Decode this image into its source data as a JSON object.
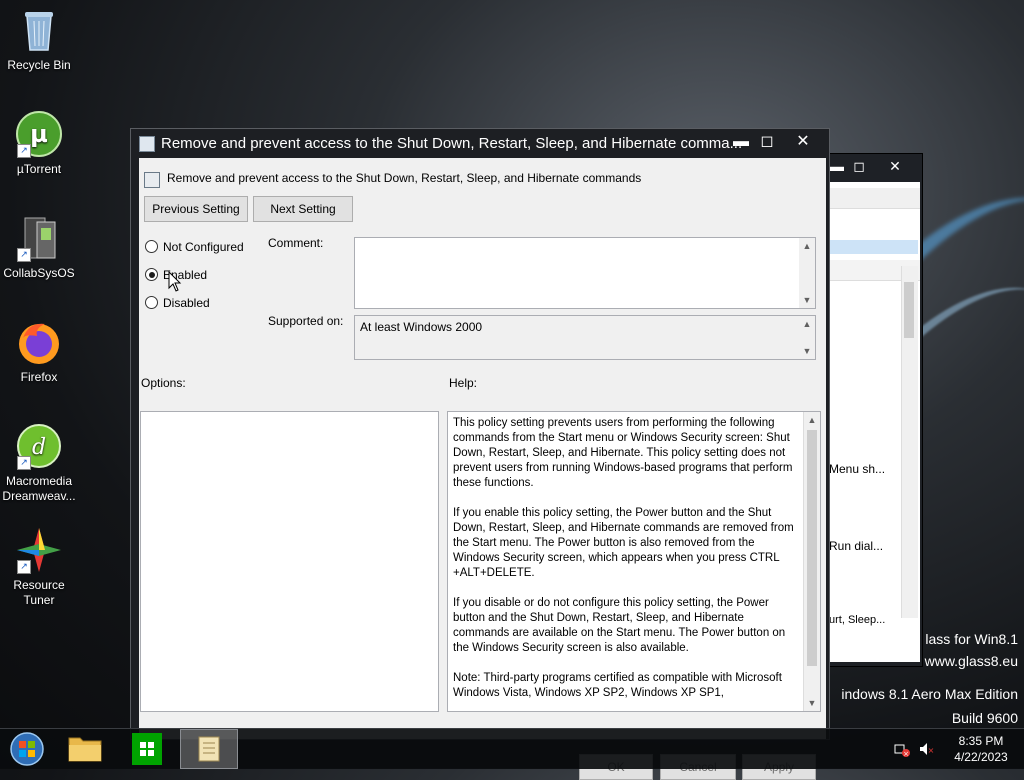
{
  "desktop": {
    "icons": [
      {
        "label": "Recycle Bin"
      },
      {
        "label": "µTorrent"
      },
      {
        "label": "CollabSysOS"
      },
      {
        "label": "Firefox"
      },
      {
        "label": "Macromedia Dreamweav..."
      },
      {
        "label": "Resource Tuner"
      }
    ],
    "watermark": {
      "line1": "lass for Win8.1",
      "line2": "www.glass8.eu",
      "line3": "indows 8.1 Aero Max Edition",
      "line4": "Build 9600"
    }
  },
  "back_window": {
    "items": [
      "Menu sh...",
      "Run dial...",
      "urt, Sleep..."
    ],
    "min": "▬",
    "max": "◻",
    "close": "✕"
  },
  "dialog": {
    "title": "Remove and prevent access to the Shut Down, Restart, Sleep, and Hibernate comma...",
    "header": "Remove and prevent access to the Shut Down, Restart, Sleep, and Hibernate commands",
    "min": "▬",
    "max": "◻",
    "close": "✕",
    "prev_button": "Previous Setting",
    "next_button": "Next Setting",
    "options": [
      {
        "label": "Not Configured",
        "checked": false
      },
      {
        "label": "Enabled",
        "checked": true
      },
      {
        "label": "Disabled",
        "checked": false
      }
    ],
    "comment_label": "Comment:",
    "comment_value": "",
    "supported_label": "Supported on:",
    "supported_value": "At least Windows 2000",
    "options_label": "Options:",
    "help_label": "Help:",
    "help": [
      "This policy setting prevents users from performing the following commands from the Start menu or Windows Security screen: Shut Down, Restart, Sleep, and Hibernate. This policy setting does not prevent users from running Windows-based programs that perform these functions.",
      "If you enable this policy setting, the Power button and the Shut Down, Restart, Sleep, and Hibernate commands are removed from the Start menu. The Power button is also removed from the Windows Security screen, which appears when you press CTRL +ALT+DELETE.",
      "If you disable or do not configure this policy setting, the Power button and the Shut Down, Restart, Sleep, and Hibernate commands are available on the Start menu. The Power button on the Windows Security screen is also available.",
      "Note: Third-party programs certified as compatible with Microsoft Windows Vista, Windows XP SP2, Windows XP SP1,"
    ],
    "ok": "OK",
    "cancel": "Cancel",
    "apply": "Apply"
  },
  "taskbar": {
    "time": "8:35 PM",
    "date": "4/22/2023",
    "items": [
      "start-orb",
      "file-explorer",
      "windows-store",
      "group-policy-editor"
    ]
  },
  "colors": {
    "accent": "#1f78d1",
    "store_green": "#00a300",
    "titlebar": "#1d1f23"
  }
}
